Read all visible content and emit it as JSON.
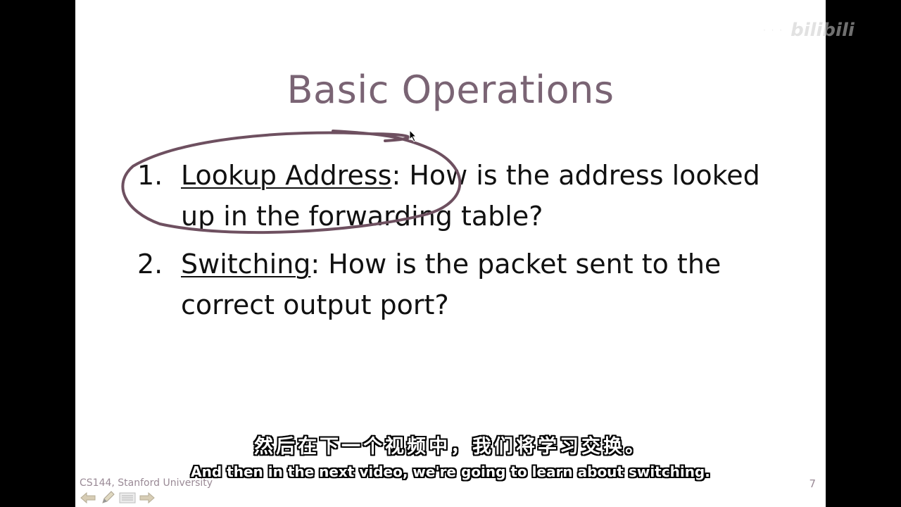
{
  "slide": {
    "title": "Basic Operations",
    "items": [
      {
        "number": "1.",
        "term": "Lookup Address",
        "text": ": How is the address looked up in the forwarding table?"
      },
      {
        "number": "2.",
        "term": "Switching",
        "text": ": How is the packet sent to the correct output port?"
      }
    ],
    "footer": "CS144, Stanford University",
    "page_number": "7"
  },
  "annotation": {
    "color": "#6e5060",
    "shape": "circle-around-item-1"
  },
  "nav": {
    "icons": [
      "arrow-left-icon",
      "pen-icon",
      "menu-icon",
      "arrow-right-icon"
    ]
  },
  "subtitles": {
    "cn": "然后在下一个视频中，我们将学习交换。",
    "en": "And then in the next video, we're going to learn about switching."
  },
  "watermark": {
    "logo": "bilibili"
  },
  "colors": {
    "title": "#7a6474",
    "text": "#111111",
    "background": "#ffffff",
    "letterbox": "#000000"
  }
}
